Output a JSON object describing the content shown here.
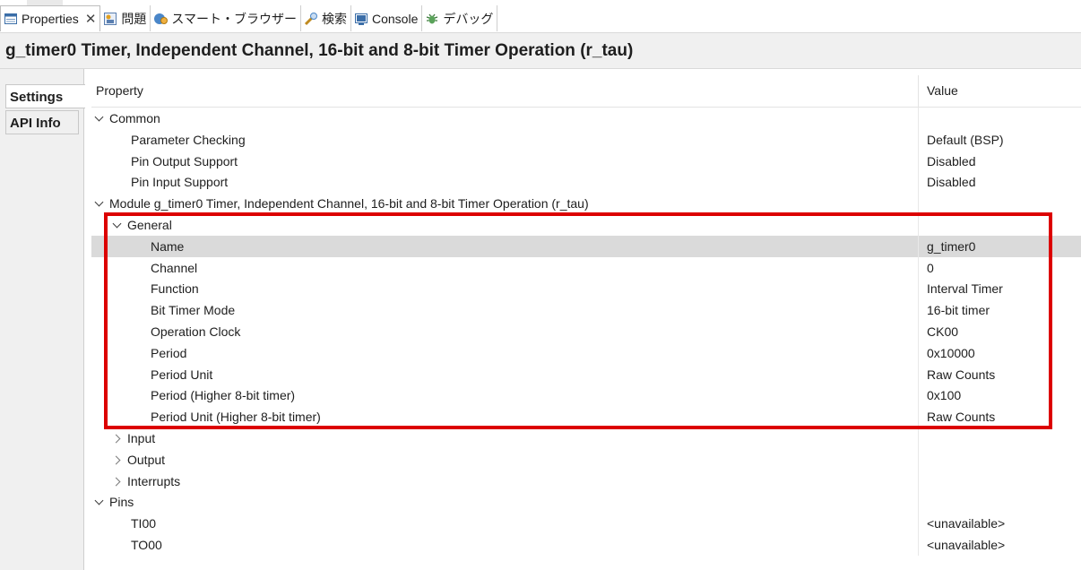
{
  "tabs": [
    {
      "label": "Properties",
      "icon": "properties-icon",
      "active": true
    },
    {
      "label": "問題",
      "icon": "problems-icon"
    },
    {
      "label": "スマート・ブラウザー",
      "icon": "smart-browser-icon"
    },
    {
      "label": "検索",
      "icon": "search-icon"
    },
    {
      "label": "Console",
      "icon": "console-icon"
    },
    {
      "label": "デバッグ",
      "icon": "debug-icon"
    }
  ],
  "title": "g_timer0 Timer, Independent Channel, 16-bit and 8-bit Timer Operation (r_tau)",
  "side_tabs": [
    "Settings",
    "API Info"
  ],
  "table": {
    "col_property": "Property",
    "col_value": "Value",
    "rows": [
      {
        "name": "Common",
        "value": "",
        "expander": "down"
      },
      {
        "name": "Parameter Checking",
        "value": "Default (BSP)"
      },
      {
        "name": "Pin Output Support",
        "value": "Disabled"
      },
      {
        "name": "Pin Input Support",
        "value": "Disabled"
      },
      {
        "name": "Module g_timer0 Timer, Independent Channel, 16-bit and 8-bit Timer Operation (r_tau)",
        "value": "",
        "expander": "down"
      },
      {
        "name": "General",
        "value": "",
        "expander": "down"
      },
      {
        "name": "Name",
        "value": "g_timer0",
        "selected": true
      },
      {
        "name": "Channel",
        "value": "0"
      },
      {
        "name": "Function",
        "value": "Interval Timer"
      },
      {
        "name": "Bit Timer Mode",
        "value": "16-bit timer"
      },
      {
        "name": "Operation Clock",
        "value": "CK00"
      },
      {
        "name": "Period",
        "value": "0x10000"
      },
      {
        "name": "Period Unit",
        "value": "Raw Counts"
      },
      {
        "name": "Period (Higher 8-bit timer)",
        "value": "0x100"
      },
      {
        "name": "Period Unit (Higher 8-bit timer)",
        "value": "Raw Counts"
      },
      {
        "name": "Input",
        "value": "",
        "expander": "right"
      },
      {
        "name": "Output",
        "value": "",
        "expander": "right"
      },
      {
        "name": "Interrupts",
        "value": "",
        "expander": "right"
      },
      {
        "name": "Pins",
        "value": "",
        "expander": "down"
      },
      {
        "name": "TI00",
        "value": "<unavailable>"
      },
      {
        "name": "TO00",
        "value": "<unavailable>"
      }
    ]
  },
  "colors": {
    "highlight": "#dc0000",
    "selected_row": "#dadada",
    "title_bg": "#f0f0f0"
  }
}
